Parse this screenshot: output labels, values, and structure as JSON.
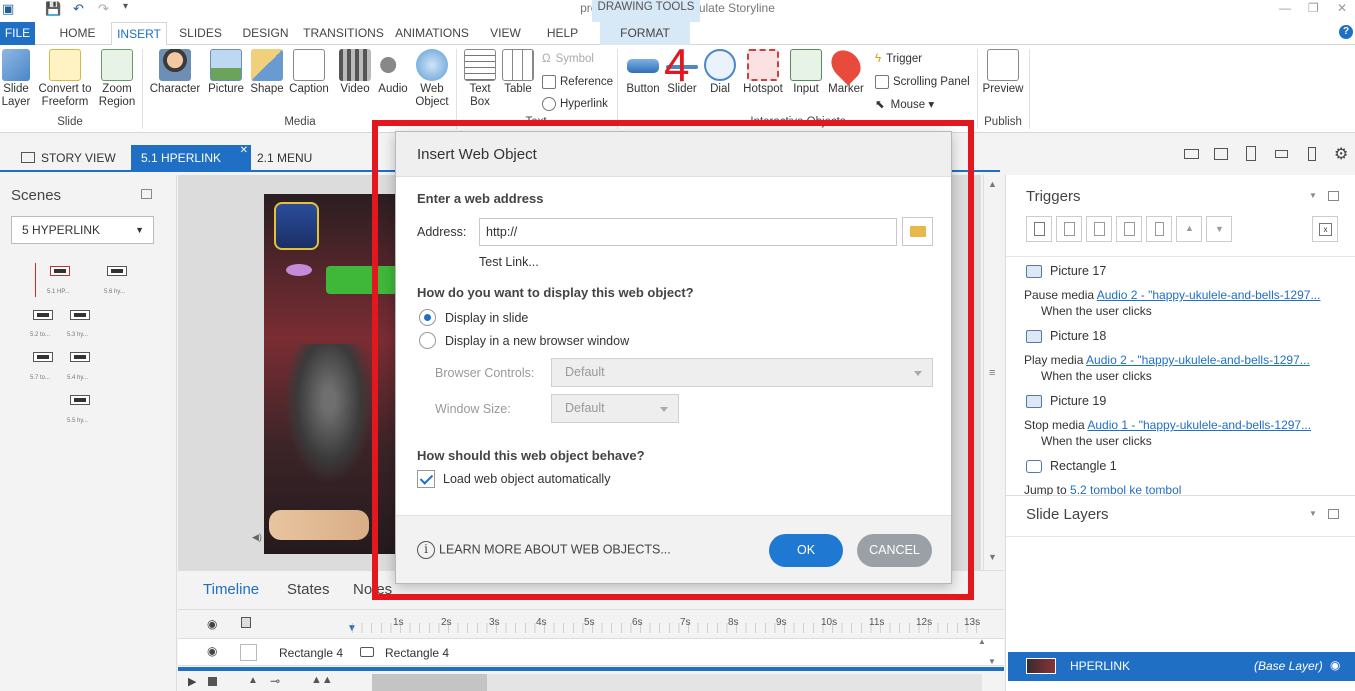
{
  "window": {
    "title": "presentasi.story - Articulate Storyline"
  },
  "menu": {
    "tabs": [
      "FILE",
      "HOME",
      "INSERT",
      "SLIDES",
      "DESIGN",
      "TRANSITIONS",
      "ANIMATIONS",
      "VIEW",
      "HELP",
      "FORMAT"
    ],
    "drawing_tools": "DRAWING TOOLS"
  },
  "ribbon": {
    "slide_group": {
      "label": "Slide",
      "items": [
        "Slide Layer",
        "Convert to Freeform",
        "Zoom Region"
      ]
    },
    "media_group": {
      "label": "Media",
      "items": [
        "Character",
        "Picture",
        "Shape",
        "Caption",
        "Video",
        "Audio",
        "Web Object"
      ]
    },
    "text_group": {
      "label": "Text",
      "items": [
        "Text Box",
        "Table"
      ],
      "small": [
        "Symbol",
        "Reference",
        "Hyperlink"
      ]
    },
    "interactive_group": {
      "label": "Interactive Objects",
      "items": [
        "Button",
        "Slider",
        "Dial",
        "Hotspot",
        "Input",
        "Marker"
      ],
      "small": [
        "Trigger",
        "Scrolling Panel",
        "Mouse"
      ]
    },
    "publish_group": {
      "label": "Publish",
      "items": [
        "Preview"
      ]
    }
  },
  "view_tabs": [
    "STORY VIEW",
    "5.1 HPERLINK",
    "2.1 MENU"
  ],
  "scenes": {
    "header": "Scenes",
    "selected": "5 HYPERLINK",
    "thumbs": [
      "5.1 HP...",
      "5.6 hy...",
      "5.2 to...",
      "5.3 hy...",
      "5.7 to...",
      "5.4 hy...",
      "5.5 hy..."
    ]
  },
  "timeline": {
    "tabs": [
      "Timeline",
      "States",
      "Notes"
    ],
    "ticks": [
      "1s",
      "2s",
      "3s",
      "4s",
      "5s",
      "6s",
      "7s",
      "8s",
      "9s",
      "10s",
      "11s",
      "12s",
      "13s"
    ],
    "row_label": "Rectangle 4",
    "bar_label": "Rectangle 4"
  },
  "triggers": {
    "header": "Triggers",
    "items": [
      {
        "object": "Picture 17",
        "action": "Pause media",
        "target": "Audio 2 - \"happy-ukulele-and-bells-1297...",
        "when": "When the user clicks"
      },
      {
        "object": "Picture 18",
        "action": "Play media",
        "target": "Audio 2 - \"happy-ukulele-and-bells-1297...",
        "when": "When the user clicks"
      },
      {
        "object": "Picture 19",
        "action": "Stop media",
        "target": "Audio 1 - \"happy-ukulele-and-bells-1297...",
        "when": "When the user clicks"
      },
      {
        "object": "Rectangle 1",
        "action": "Jump to",
        "target": "5.2 tombol ke tombol",
        "when": ""
      }
    ]
  },
  "slide_layers": {
    "header": "Slide Layers",
    "base_name": "HPERLINK",
    "base_tag": "(Base Layer)"
  },
  "dialog": {
    "title": "Insert Web Object",
    "section_address": "Enter a web address",
    "address_label": "Address:",
    "address_value": "http://",
    "test_link": "Test Link...",
    "section_display": "How do you want to display this web object?",
    "opt_slide": "Display in slide",
    "opt_browser": "Display in a new browser window",
    "browser_controls_label": "Browser Controls:",
    "browser_controls_value": "Default",
    "window_size_label": "Window Size:",
    "window_size_value": "Default",
    "section_behave": "How should this web object behave?",
    "load_auto": "Load web object automatically",
    "learn_more": "LEARN MORE ABOUT WEB OBJECTS...",
    "ok": "OK",
    "cancel": "CANCEL"
  },
  "annotation": {
    "step_number": "4",
    "color": "#e3171e"
  },
  "colors": {
    "accent": "#1f6fc5",
    "ok_button": "#1f78d1",
    "cancel_button": "#9aa0a6"
  }
}
